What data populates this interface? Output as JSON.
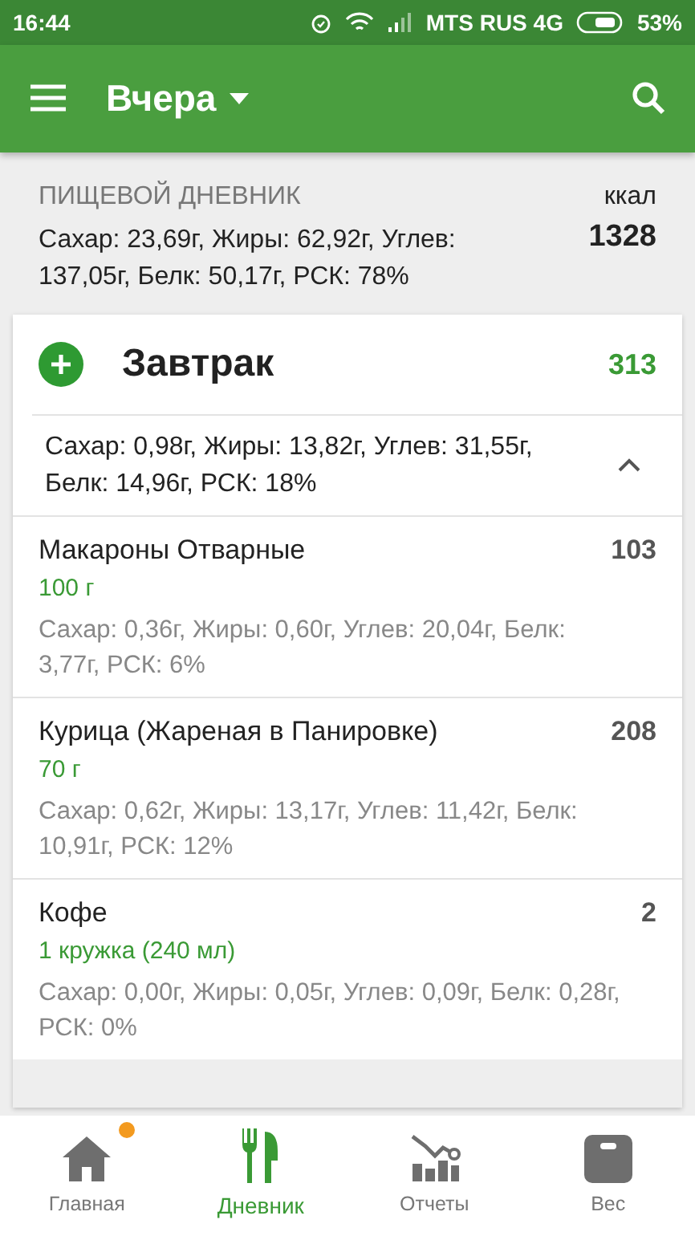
{
  "status_bar": {
    "time": "16:44",
    "carrier": "MTS RUS 4G",
    "battery": "53%"
  },
  "app_bar": {
    "title": "Вчера"
  },
  "summary": {
    "heading": "ПИЩЕВОЙ ДНЕВНИК",
    "unit": "ккал",
    "nutrients": "Сахар: 23,69г, Жиры: 62,92г, Углев: 137,05г, Белк: 50,17г, РСК: 78%",
    "calories": "1328"
  },
  "meal": {
    "name": "Завтрак",
    "calories": "313",
    "nutrients": "Сахар: 0,98г, Жиры: 13,82г, Углев: 31,55г, Белк: 14,96г, РСК: 18%",
    "expanded": true,
    "items": [
      {
        "name": "Макароны Отварные",
        "amount": "100  г",
        "calories": "103",
        "nutrients": "Сахар: 0,36г, Жиры: 0,60г, Углев: 20,04г, Белк: 3,77г, РСК: 6%"
      },
      {
        "name": "Курица (Жареная в Панировке)",
        "amount": "70  г",
        "calories": "208",
        "nutrients": "Сахар: 0,62г, Жиры: 13,17г, Углев: 11,42г, Белк: 10,91г, РСК: 12%"
      },
      {
        "name": "Кофе",
        "amount": "1 кружка (240 мл)",
        "calories": "2",
        "nutrients": "Сахар: 0,00г, Жиры: 0,05г, Углев: 0,09г, Белк: 0,28г, РСК: 0%"
      }
    ]
  },
  "bottom_nav": [
    {
      "kind": "home",
      "label": "Главная",
      "selected": false,
      "badge": true
    },
    {
      "kind": "diary",
      "label": "Дневник",
      "selected": true,
      "badge": false
    },
    {
      "kind": "reports",
      "label": "Отчеты",
      "selected": false,
      "badge": false
    },
    {
      "kind": "weight",
      "label": "Вес",
      "selected": false,
      "badge": false
    }
  ]
}
